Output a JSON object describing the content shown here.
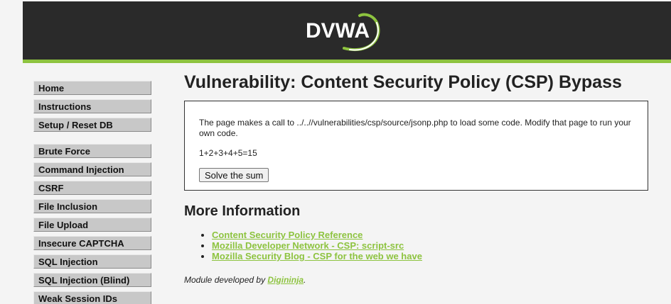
{
  "header": {
    "logo_text": "DVWA",
    "colors": {
      "header_bg": "#2a2a2a",
      "accent": "#8dc33f"
    }
  },
  "menu": {
    "blocks": [
      [
        {
          "label": "Home"
        },
        {
          "label": "Instructions"
        },
        {
          "label": "Setup / Reset DB"
        }
      ],
      [
        {
          "label": "Brute Force"
        },
        {
          "label": "Command Injection"
        },
        {
          "label": "CSRF"
        },
        {
          "label": "File Inclusion"
        },
        {
          "label": "File Upload"
        },
        {
          "label": "Insecure CAPTCHA"
        },
        {
          "label": "SQL Injection"
        },
        {
          "label": "SQL Injection (Blind)"
        },
        {
          "label": "Weak Session IDs"
        }
      ]
    ]
  },
  "main": {
    "title": "Vulnerability: Content Security Policy (CSP) Bypass",
    "description": "The page makes a call to ../..//vulnerabilities/csp/source/jsonp.php to load some code. Modify that page to run your own code.",
    "sum_text": "1+2+3+4+5=15",
    "solve_button_label": "Solve the sum",
    "more_info_title": "More Information",
    "links": [
      {
        "label": "Content Security Policy Reference"
      },
      {
        "label": "Mozilla Developer Network - CSP: script-src"
      },
      {
        "label": "Mozilla Security Blog - CSP for the web we have"
      }
    ],
    "module_credit_prefix": "Module developed by ",
    "module_credit_author": "Digininja",
    "module_credit_suffix": "."
  }
}
